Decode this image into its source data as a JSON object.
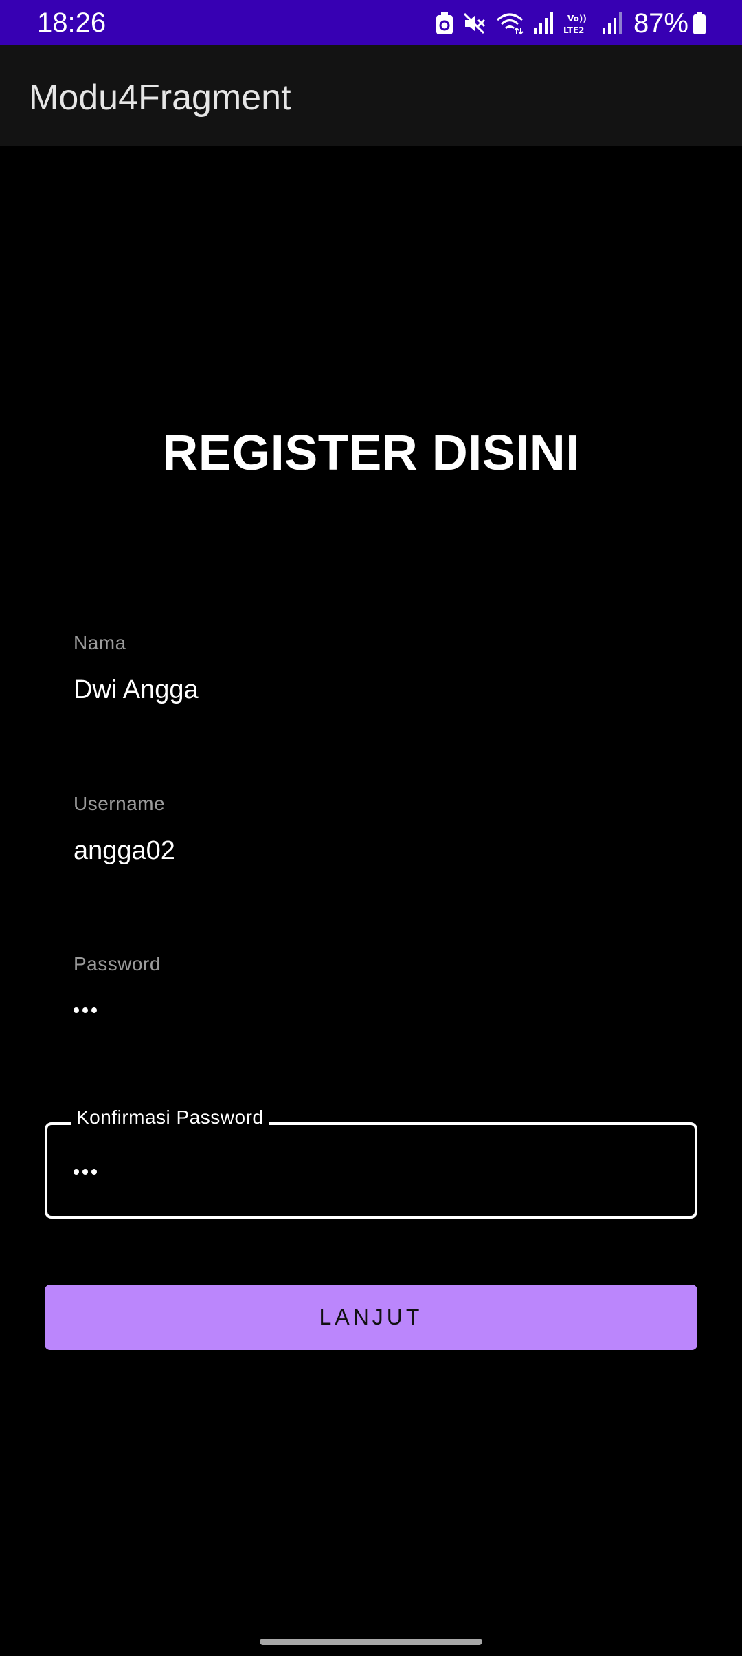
{
  "status_bar": {
    "time": "18:26",
    "battery_percent": "87%",
    "background_color": "#3700b3",
    "icons": [
      "usb-icon",
      "mute-icon",
      "wifi-icon",
      "signal-icon",
      "volte-lte2-icon",
      "signal-icon",
      "battery-icon"
    ]
  },
  "app_bar": {
    "title": "Modu4Fragment"
  },
  "form": {
    "heading": "REGISTER DISINI",
    "fields": [
      {
        "label": "Nama",
        "value": "Dwi Angga"
      },
      {
        "label": "Username",
        "value": "angga02"
      },
      {
        "label": "Password",
        "value": "•••"
      },
      {
        "label": "Konfirmasi Password",
        "value": "•••"
      }
    ],
    "submit_label": "LANJUT",
    "accent_color": "#bb86fc"
  }
}
